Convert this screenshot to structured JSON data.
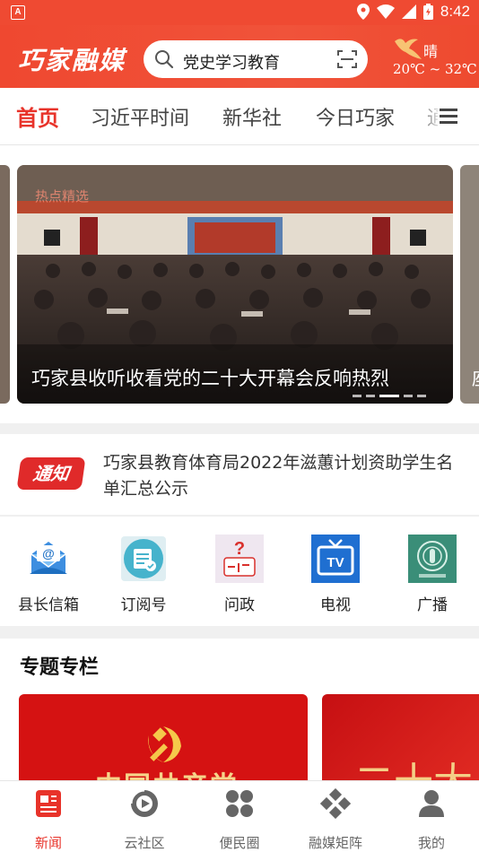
{
  "status_bar": {
    "time": "8:42"
  },
  "header": {
    "logo": "巧家融媒",
    "search_text": "党史学习教育",
    "weather_condition": "晴",
    "weather_temp": "20℃ ~ 32℃"
  },
  "tabs": [
    {
      "label": "首页",
      "active": true
    },
    {
      "label": "习近平时间"
    },
    {
      "label": "新华社"
    },
    {
      "label": "今日巧家"
    },
    {
      "label": "通"
    }
  ],
  "banner": {
    "tag": "热点精选",
    "caption": "巧家县收听收看党的二十大开幕会反响热烈",
    "peek_caption": "座",
    "dot_count": 5,
    "active_dot": 3
  },
  "notice": {
    "badge": "通知",
    "text": "巧家县教育体育局2022年滋蕙计划资助学生名单汇总公示"
  },
  "quick_links": [
    {
      "label": "县长信箱",
      "icon": "mailbox-icon"
    },
    {
      "label": "订阅号",
      "icon": "subscription-icon"
    },
    {
      "label": "问政",
      "icon": "inquiry-icon"
    },
    {
      "label": "电视",
      "icon": "tv-icon"
    },
    {
      "label": "广播",
      "icon": "radio-icon"
    }
  ],
  "special": {
    "title": "专题专栏",
    "card1_text": "中国共产党",
    "card2_text": "二十大"
  },
  "bottom_nav": [
    {
      "label": "新闻",
      "icon": "news-icon",
      "active": true
    },
    {
      "label": "云社区",
      "icon": "cloud-community-icon"
    },
    {
      "label": "便民圈",
      "icon": "services-icon"
    },
    {
      "label": "融媒矩阵",
      "icon": "matrix-icon"
    },
    {
      "label": "我的",
      "icon": "profile-icon"
    }
  ],
  "colors": {
    "brand_red": "#ef4a32",
    "accent_red": "#e8332a"
  }
}
